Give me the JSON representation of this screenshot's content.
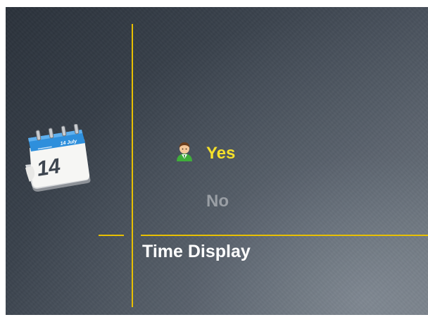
{
  "menu": {
    "options": [
      {
        "label": "Yes",
        "selected": true
      },
      {
        "label": "No",
        "selected": false
      }
    ],
    "section_title": "Time Display"
  },
  "calendar_icon": {
    "month": "14 July",
    "day": "14"
  },
  "icons": {
    "calendar": "calendar-icon",
    "selected_option": "user-icon"
  },
  "colors": {
    "accent": "#e8c000",
    "selected_text": "#f5e02a",
    "unselected_text": "#9a9fa5",
    "title_text": "#ffffff"
  }
}
